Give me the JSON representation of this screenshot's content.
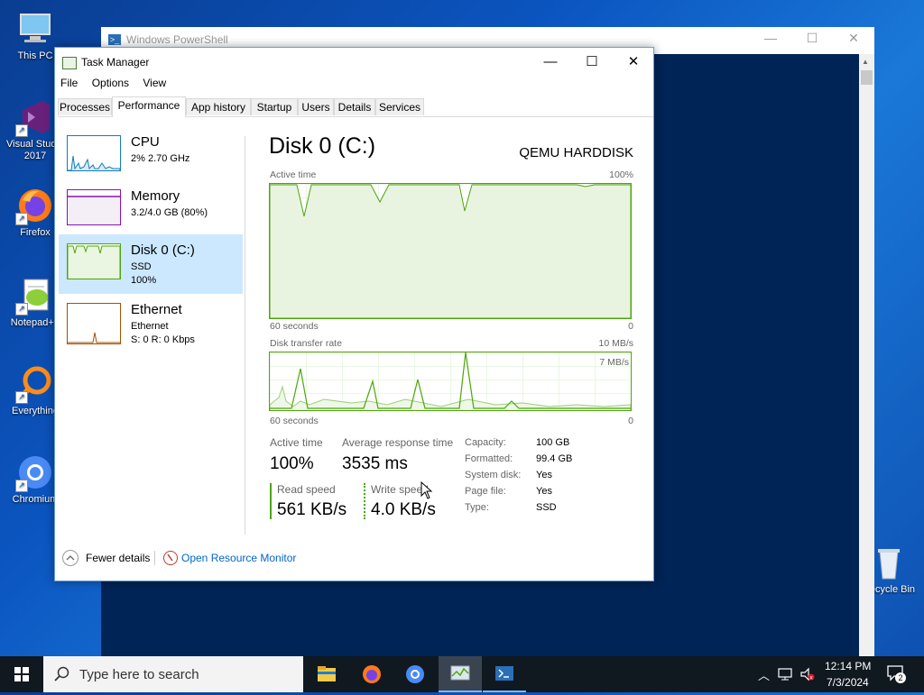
{
  "desktop": {
    "icons": [
      {
        "label": "This PC"
      },
      {
        "label": "Visual Studio 2017"
      },
      {
        "label": "Firefox"
      },
      {
        "label": "Notepad++"
      },
      {
        "label": "Everything"
      },
      {
        "label": "Chromium"
      },
      {
        "label": "Recycle Bin"
      }
    ]
  },
  "powershell": {
    "title": "Windows PowerShell",
    "min_glyph": "—",
    "max_glyph": "☐",
    "close_glyph": "✕"
  },
  "taskmgr": {
    "title": "Task Manager",
    "menu": [
      "File",
      "Options",
      "View"
    ],
    "tabs": [
      "Processes",
      "Performance",
      "App history",
      "Startup",
      "Users",
      "Details",
      "Services"
    ],
    "active_tab": "Performance",
    "controls": {
      "min": "—",
      "max": "☐",
      "close": "✕"
    },
    "sidebar": [
      {
        "name": "CPU",
        "sub1": "2% 2.70 GHz",
        "sub2": "",
        "color": "#117dbb"
      },
      {
        "name": "Memory",
        "sub1": "3.2/4.0 GB (80%)",
        "sub2": "",
        "color": "#8b12ae"
      },
      {
        "name": "Disk 0 (C:)",
        "sub1": "SSD",
        "sub2": "100%",
        "color": "#4da60c"
      },
      {
        "name": "Ethernet",
        "sub1": "Ethernet",
        "sub2": "S: 0 R: 0 Kbps",
        "color": "#a74f01"
      }
    ],
    "detail": {
      "title": "Disk 0 (C:)",
      "model": "QEMU HARDDISK",
      "graph1": {
        "label": "Active time",
        "max": "100%",
        "time": "60 seconds",
        "min": "0"
      },
      "graph2": {
        "label": "Disk transfer rate",
        "max": "10 MB/s",
        "inner": "7 MB/s",
        "time": "60 seconds",
        "min": "0"
      },
      "stats": {
        "active_time_label": "Active time",
        "active_time": "100%",
        "avg_resp_label": "Average response time",
        "avg_resp": "3535 ms",
        "read_label": "Read speed",
        "read": "561 KB/s",
        "write_label": "Write speed",
        "write": "4.0 KB/s"
      },
      "props": [
        {
          "k": "Capacity:",
          "v": "100 GB"
        },
        {
          "k": "Formatted:",
          "v": "99.4 GB"
        },
        {
          "k": "System disk:",
          "v": "Yes"
        },
        {
          "k": "Page file:",
          "v": "Yes"
        },
        {
          "k": "Type:",
          "v": "SSD"
        }
      ]
    },
    "footer": {
      "fewer": "Fewer details",
      "resmon": "Open Resource Monitor"
    }
  },
  "taskbar": {
    "search_placeholder": "Type here to search",
    "time": "12:14 PM",
    "date": "7/3/2024",
    "notif_count": "2"
  }
}
